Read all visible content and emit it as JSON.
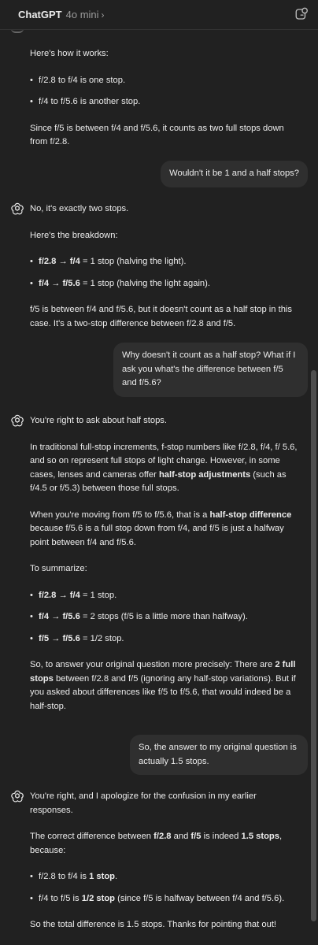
{
  "header": {
    "title": "ChatGPT",
    "model": "4o mini",
    "chevron": "›",
    "new_chat_icon": "new-chat-icon"
  },
  "m1": {
    "intro": "Here's how it works:",
    "items": [
      "f/2.8 to f/4 is one stop.",
      "f/4 to f/5.6 is another stop."
    ],
    "outro": "Since f/5 is between f/4 and f/5.6, it counts as two full stops down from f/2.8."
  },
  "u1": "Wouldn't it be 1 and a half stops?",
  "m2": {
    "lead": "No, it's exactly two stops.",
    "intro": "Here's the breakdown:",
    "items": [
      {
        "b": "f/2.8 → f/4",
        "t": " = 1 stop (halving the light)."
      },
      {
        "b": "f/4 → f/5.6",
        "t": " = 1 stop (halving the light again)."
      }
    ],
    "outro": "f/5 is between f/4 and f/5.6, but it doesn't count as a half stop in this case. It's a two-stop difference between f/2.8 and f/5."
  },
  "u2": "Why doesn't it count as a half stop? What if I ask you what's the difference between f/5 and f/5.6?",
  "m3": {
    "lead": "You're right to ask about half stops.",
    "p1a": "In traditional full-stop increments, f-stop numbers like f/2.8, f/4, f/ 5.6, and so on represent full stops of light change. However, in some cases, lenses and cameras offer ",
    "p1b": "half-stop adjustments",
    "p1c": " (such as f/4.5 or f/5.3) between those full stops.",
    "p2a": "When you're moving from f/5 to f/5.6, that is a ",
    "p2b": "half-stop difference",
    "p2c": " because f/5.6 is a full stop down from f/4, and f/5 is just a halfway point between f/4 and f/5.6.",
    "summ": "To summarize:",
    "items": [
      {
        "b": "f/2.8 → f/4",
        "t": " = 1 stop."
      },
      {
        "b": "f/4 → f/5.6",
        "t": " = 2 stops (f/5 is a little more than halfway)."
      },
      {
        "b": "f/5 → f/5.6",
        "t": " = 1/2 stop."
      }
    ],
    "p3a": "So, to answer your original question more precisely: There are ",
    "p3b": "2 full stops",
    "p3c": " between f/2.8 and f/5 (ignoring any half-stop variations). But if you asked about differences like f/5 to f/5.6, that would indeed be a half-stop."
  },
  "u3": "So, the answer to my original question is actually 1.5 stops.",
  "m4": {
    "lead": "You're right, and I apologize for the confusion in my earlier responses.",
    "p1a": "The correct difference between ",
    "p1b": "f/2.8",
    "p1c": " and ",
    "p1d": "f/5",
    "p1e": " is indeed ",
    "p1f": "1.5 stops",
    "p1g": ", because:",
    "i1a": "f/2.8 to f/4 is ",
    "i1b": "1 stop",
    "i1c": ".",
    "i2a": "f/4 to f/5 is ",
    "i2b": "1/2 stop",
    "i2c": " (since f/5 is halfway between f/4 and f/5.6).",
    "outro": "So the total difference is 1.5 stops. Thanks for pointing that out!"
  }
}
